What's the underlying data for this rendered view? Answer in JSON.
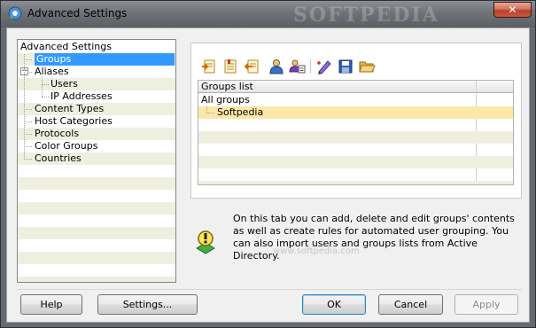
{
  "window": {
    "title": "Advanced Settings",
    "watermark": "SOFTPEDIA"
  },
  "tree": {
    "items": [
      {
        "label": "Advanced Settings",
        "level": 0,
        "selected": false
      },
      {
        "label": "Groups",
        "level": 1,
        "selected": true
      },
      {
        "label": "Aliases",
        "level": 1,
        "selected": false,
        "expander": "−"
      },
      {
        "label": "Users",
        "level": 2,
        "selected": false
      },
      {
        "label": "IP Addresses",
        "level": 2,
        "selected": false
      },
      {
        "label": "Content Types",
        "level": 1,
        "selected": false
      },
      {
        "label": "Host Categories",
        "level": 1,
        "selected": false
      },
      {
        "label": "Protocols",
        "level": 1,
        "selected": false
      },
      {
        "label": "Color Groups",
        "level": 1,
        "selected": false
      },
      {
        "label": "Countries",
        "level": 1,
        "selected": false
      }
    ]
  },
  "toolbar": {
    "buttons": [
      {
        "name": "add-group-icon"
      },
      {
        "name": "edit-group-icon"
      },
      {
        "name": "delete-group-icon"
      },
      {
        "name": "add-user-icon"
      },
      {
        "name": "group-rules-icon"
      },
      {
        "name": "edit-rules-icon"
      },
      {
        "name": "save-icon"
      },
      {
        "name": "open-folder-icon"
      }
    ]
  },
  "grid": {
    "header": "Groups list",
    "rows": [
      {
        "label": "All groups",
        "indent": 0,
        "selected": false
      },
      {
        "label": "Softpedia",
        "indent": 1,
        "selected": true
      }
    ]
  },
  "info": {
    "text": "On this tab you can add, delete and edit groups' contents as well as create rules for automated user grouping. You can also import users and groups lists from Active Directory.",
    "watermark": "www.softpedia.com"
  },
  "buttons": {
    "help": "Help",
    "settings": "Settings...",
    "ok": "OK",
    "cancel": "Cancel",
    "apply": "Apply"
  },
  "colors": {
    "selection": "#3399ff",
    "grid_selection": "#fbe8a9",
    "alt_row": "#efefe0"
  }
}
